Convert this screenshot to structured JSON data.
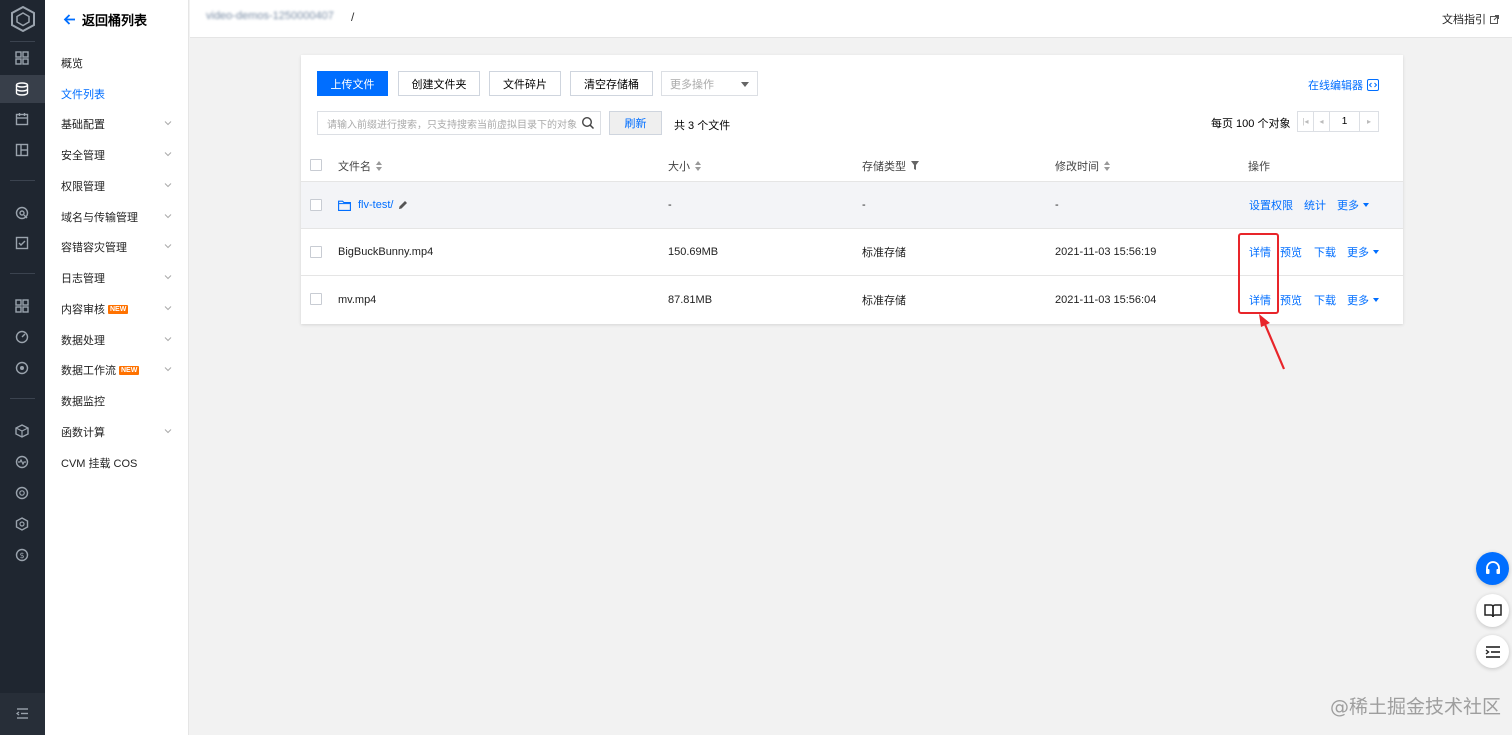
{
  "rail": {
    "icons": [
      "cube-logo-icon",
      "dashboard-icon",
      "database-icon",
      "calendar-icon",
      "layout-icon",
      "monitor-icon",
      "checklist-icon",
      "grid-icon",
      "speed-icon",
      "target-icon",
      "box-icon",
      "pulse-icon",
      "scan-icon",
      "hex-gear-icon",
      "dollar-icon",
      "menu-collapse-icon"
    ]
  },
  "nav": {
    "back_label": "返回桶列表",
    "items": [
      {
        "label": "概览",
        "active": false,
        "expandable": false
      },
      {
        "label": "文件列表",
        "active": true,
        "expandable": false
      },
      {
        "label": "基础配置",
        "active": false,
        "expandable": true
      },
      {
        "label": "安全管理",
        "active": false,
        "expandable": true
      },
      {
        "label": "权限管理",
        "active": false,
        "expandable": true
      },
      {
        "label": "域名与传输管理",
        "active": false,
        "expandable": true
      },
      {
        "label": "容错容灾管理",
        "active": false,
        "expandable": true
      },
      {
        "label": "日志管理",
        "active": false,
        "expandable": true
      },
      {
        "label": "内容审核",
        "active": false,
        "expandable": true,
        "badge": "NEW"
      },
      {
        "label": "数据处理",
        "active": false,
        "expandable": true
      },
      {
        "label": "数据工作流",
        "active": false,
        "expandable": true,
        "badge": "NEW"
      },
      {
        "label": "数据监控",
        "active": false,
        "expandable": false
      },
      {
        "label": "函数计算",
        "active": false,
        "expandable": true
      },
      {
        "label": "CVM 挂载 COS",
        "active": false,
        "expandable": false
      }
    ]
  },
  "header": {
    "bucket_path": "video-demos-1250000407",
    "separator": "/",
    "doc_link": "文档指引"
  },
  "toolbar": {
    "upload": "上传文件",
    "create_folder": "创建文件夹",
    "fragments": "文件碎片",
    "clear_bucket": "清空存储桶",
    "more_ops": "更多操作",
    "online_editor": "在线编辑器"
  },
  "search": {
    "placeholder": "请输入前缀进行搜索，只支持搜索当前虚拟目录下的对象",
    "refresh": "刷新",
    "count_text": "共 3 个文件",
    "per_page": "每页 100 个对象",
    "page": "1"
  },
  "table": {
    "headers": {
      "name": "文件名",
      "size": "大小",
      "storage": "存储类型",
      "modified": "修改时间",
      "actions": "操作"
    },
    "rows": [
      {
        "name": "flv-test/",
        "size": "-",
        "storage": "-",
        "modified": "-",
        "actions": [
          "设置权限",
          "统计"
        ],
        "more": "更多",
        "is_folder": true
      },
      {
        "name": "BigBuckBunny.mp4",
        "size": "150.69MB",
        "storage": "标准存储",
        "modified": "2021-11-03 15:56:19",
        "actions": [
          "详情",
          "预览",
          "下载"
        ],
        "more": "更多",
        "is_folder": false
      },
      {
        "name": "mv.mp4",
        "size": "87.81MB",
        "storage": "标准存储",
        "modified": "2021-11-03 15:56:04",
        "actions": [
          "详情",
          "预览",
          "下载"
        ],
        "more": "更多",
        "is_folder": false
      }
    ]
  },
  "floating": [
    "headset-icon",
    "book-icon",
    "list-indent-icon"
  ],
  "watermark": "@稀土掘金技术社区",
  "colors": {
    "accent": "#006eff",
    "annotation": "#e8252a",
    "rail": "#1f2630",
    "badge": "#ff7200"
  }
}
